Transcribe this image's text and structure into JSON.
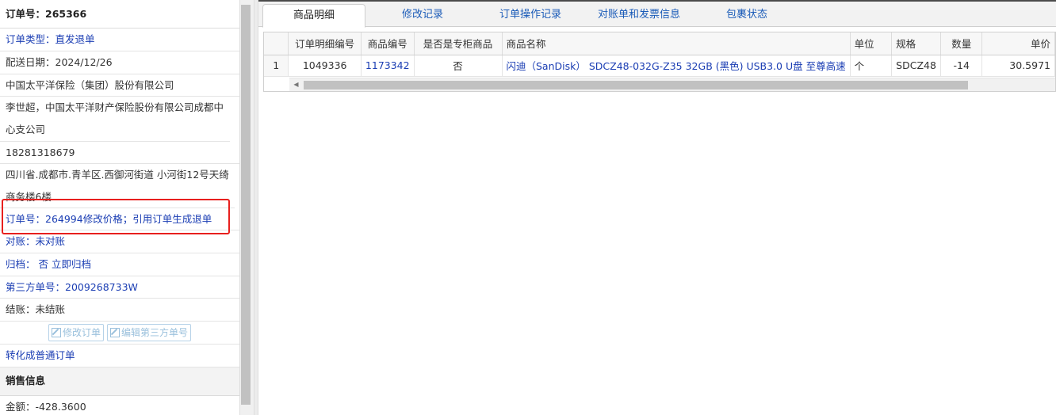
{
  "order": {
    "title": "订单号：265366",
    "type": "订单类型：直发退单",
    "delivery_date": "配送日期：2024/12/26",
    "company": "中国太平洋保险（集团）股份有限公司",
    "contact": "李世超，中国太平洋财产保险股份有限公司成都中心支公司",
    "phone": "18281318679",
    "address": "四川省.成都市.青羊区.西御河街道 小河街12号天绮商务楼6楼",
    "ref_note": "订单号：264994修改价格；引用订单生成退单",
    "reconcile": "对账：未对账",
    "archive": "归档： 否 立即归档",
    "third_party": "第三方单号：2009268733W",
    "settle": "结账：未结账",
    "edit_order_btn": "修改订单",
    "edit_third_btn": "编辑第三方单号",
    "convert": "转化成普通订单"
  },
  "sales": {
    "header": "销售信息",
    "amount": "金额：-428.3600"
  },
  "tabs": [
    {
      "label": "商品明细",
      "active": true
    },
    {
      "label": "修改记录",
      "active": false
    },
    {
      "label": "订单操作记录",
      "active": false
    },
    {
      "label": "对账单和发票信息",
      "active": false
    },
    {
      "label": "包裹状态",
      "active": false
    }
  ],
  "table": {
    "columns": [
      "",
      "订单明细编号",
      "商品编号",
      "是否是专柜商品",
      "商品名称",
      "单位",
      "规格",
      "数量",
      "单价"
    ],
    "rows": [
      [
        "1",
        "1049336",
        "1173342",
        "否",
        "闪迪（SanDisk） SDCZ48-032G-Z35 32GB (黑色) USB3.0 U盘 至尊高速",
        "个",
        "SDCZ48",
        "-14",
        "30.5971"
      ]
    ]
  },
  "colors": {
    "link": "#1a3db3",
    "highlight": "#e8201e"
  }
}
